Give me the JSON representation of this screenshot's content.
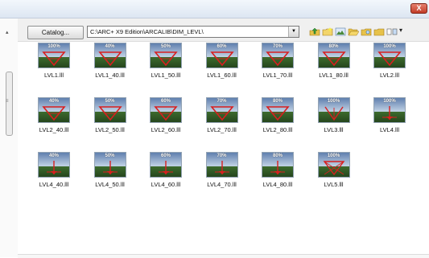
{
  "window": {
    "close_glyph": "X"
  },
  "scrollbar": {
    "up_glyph": "▴",
    "grip_glyph": "≡"
  },
  "toolbar": {
    "catalog_label": "Catalog...",
    "path_value": "C:\\ARC+ X9 Edition\\ARCALIB\\DIM_LEVL\\",
    "dropdown_glyph": "▼",
    "icons": [
      "folder-up-icon",
      "new-folder-icon",
      "image-folder-icon",
      "open-folder-icon",
      "folder-search-icon",
      "folder-icon",
      "view-mode-icon"
    ],
    "view_drop_glyph": "▾"
  },
  "tiles": [
    {
      "label": "LVL1.lll",
      "pct": "100%",
      "shape": "triangle"
    },
    {
      "label": "LVL1_40.lll",
      "pct": "40%",
      "shape": "triangle"
    },
    {
      "label": "LVL1_50.lll",
      "pct": "50%",
      "shape": "triangle"
    },
    {
      "label": "LVL1_60.lll",
      "pct": "60%",
      "shape": "triangle"
    },
    {
      "label": "LVL1_70.lll",
      "pct": "70%",
      "shape": "triangle"
    },
    {
      "label": "LVL1_80.lll",
      "pct": "80%",
      "shape": "triangle"
    },
    {
      "label": "LVL2.lll",
      "pct": "100%",
      "shape": "triangle"
    },
    {
      "label": "LVL2_40.lll",
      "pct": "40%",
      "shape": "triangle"
    },
    {
      "label": "LVL2_50.lll",
      "pct": "50%",
      "shape": "triangle"
    },
    {
      "label": "LVL2_60.lll",
      "pct": "60%",
      "shape": "triangle"
    },
    {
      "label": "LVL2_70.lll",
      "pct": "70%",
      "shape": "triangle"
    },
    {
      "label": "LVL2_80.lll",
      "pct": "80%",
      "shape": "triangle"
    },
    {
      "label": "LVL3.lll",
      "pct": "100%",
      "shape": "vee"
    },
    {
      "label": "LVL4.lll",
      "pct": "100%",
      "shape": "marker"
    },
    {
      "label": "LVL4_40.lll",
      "pct": "40%",
      "shape": "marker"
    },
    {
      "label": "LVL4_50.lll",
      "pct": "50%",
      "shape": "marker"
    },
    {
      "label": "LVL4_60.lll",
      "pct": "60%",
      "shape": "marker"
    },
    {
      "label": "LVL4_70.lll",
      "pct": "70%",
      "shape": "marker"
    },
    {
      "label": "LVL4_80.lll",
      "pct": "80%",
      "shape": "marker"
    },
    {
      "label": "LVL5.lll",
      "pct": "100%",
      "shape": "bowtie"
    }
  ],
  "colors": {
    "sky_top": "#5f7fae",
    "sky_bottom": "#c3d3e6",
    "ground_top": "#3d6b2e",
    "ground_bottom": "#25461d",
    "symbol": "#d81f1f"
  }
}
